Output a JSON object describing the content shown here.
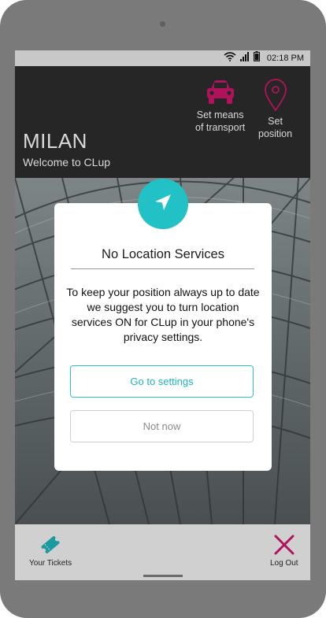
{
  "colors": {
    "accent": "#21c1c6",
    "brand": "#b0135c",
    "header_bg": "#262626"
  },
  "statusbar": {
    "time": "02:18 PM",
    "icons": [
      "wifi-icon",
      "signal-icon",
      "battery-icon"
    ]
  },
  "header": {
    "city": "MILAN",
    "welcome": "Welcome to CLup",
    "actions": [
      {
        "icon": "car-icon",
        "label_line1": "Set means",
        "label_line2": "of transport"
      },
      {
        "icon": "location-pin-icon",
        "label_line1": "Set",
        "label_line2": "position"
      }
    ]
  },
  "modal": {
    "icon": "navigation-arrow-icon",
    "title": "No Location Services",
    "body": "To keep your position always up to date we suggest you to turn location services ON for CLup in your phone's privacy settings.",
    "primary_button": "Go to settings",
    "secondary_button": "Not now"
  },
  "bottombar": {
    "tickets_label": "Your Tickets",
    "tickets_icon": "ticket-icon",
    "logout_label": "Log Out",
    "logout_icon": "close-icon"
  }
}
